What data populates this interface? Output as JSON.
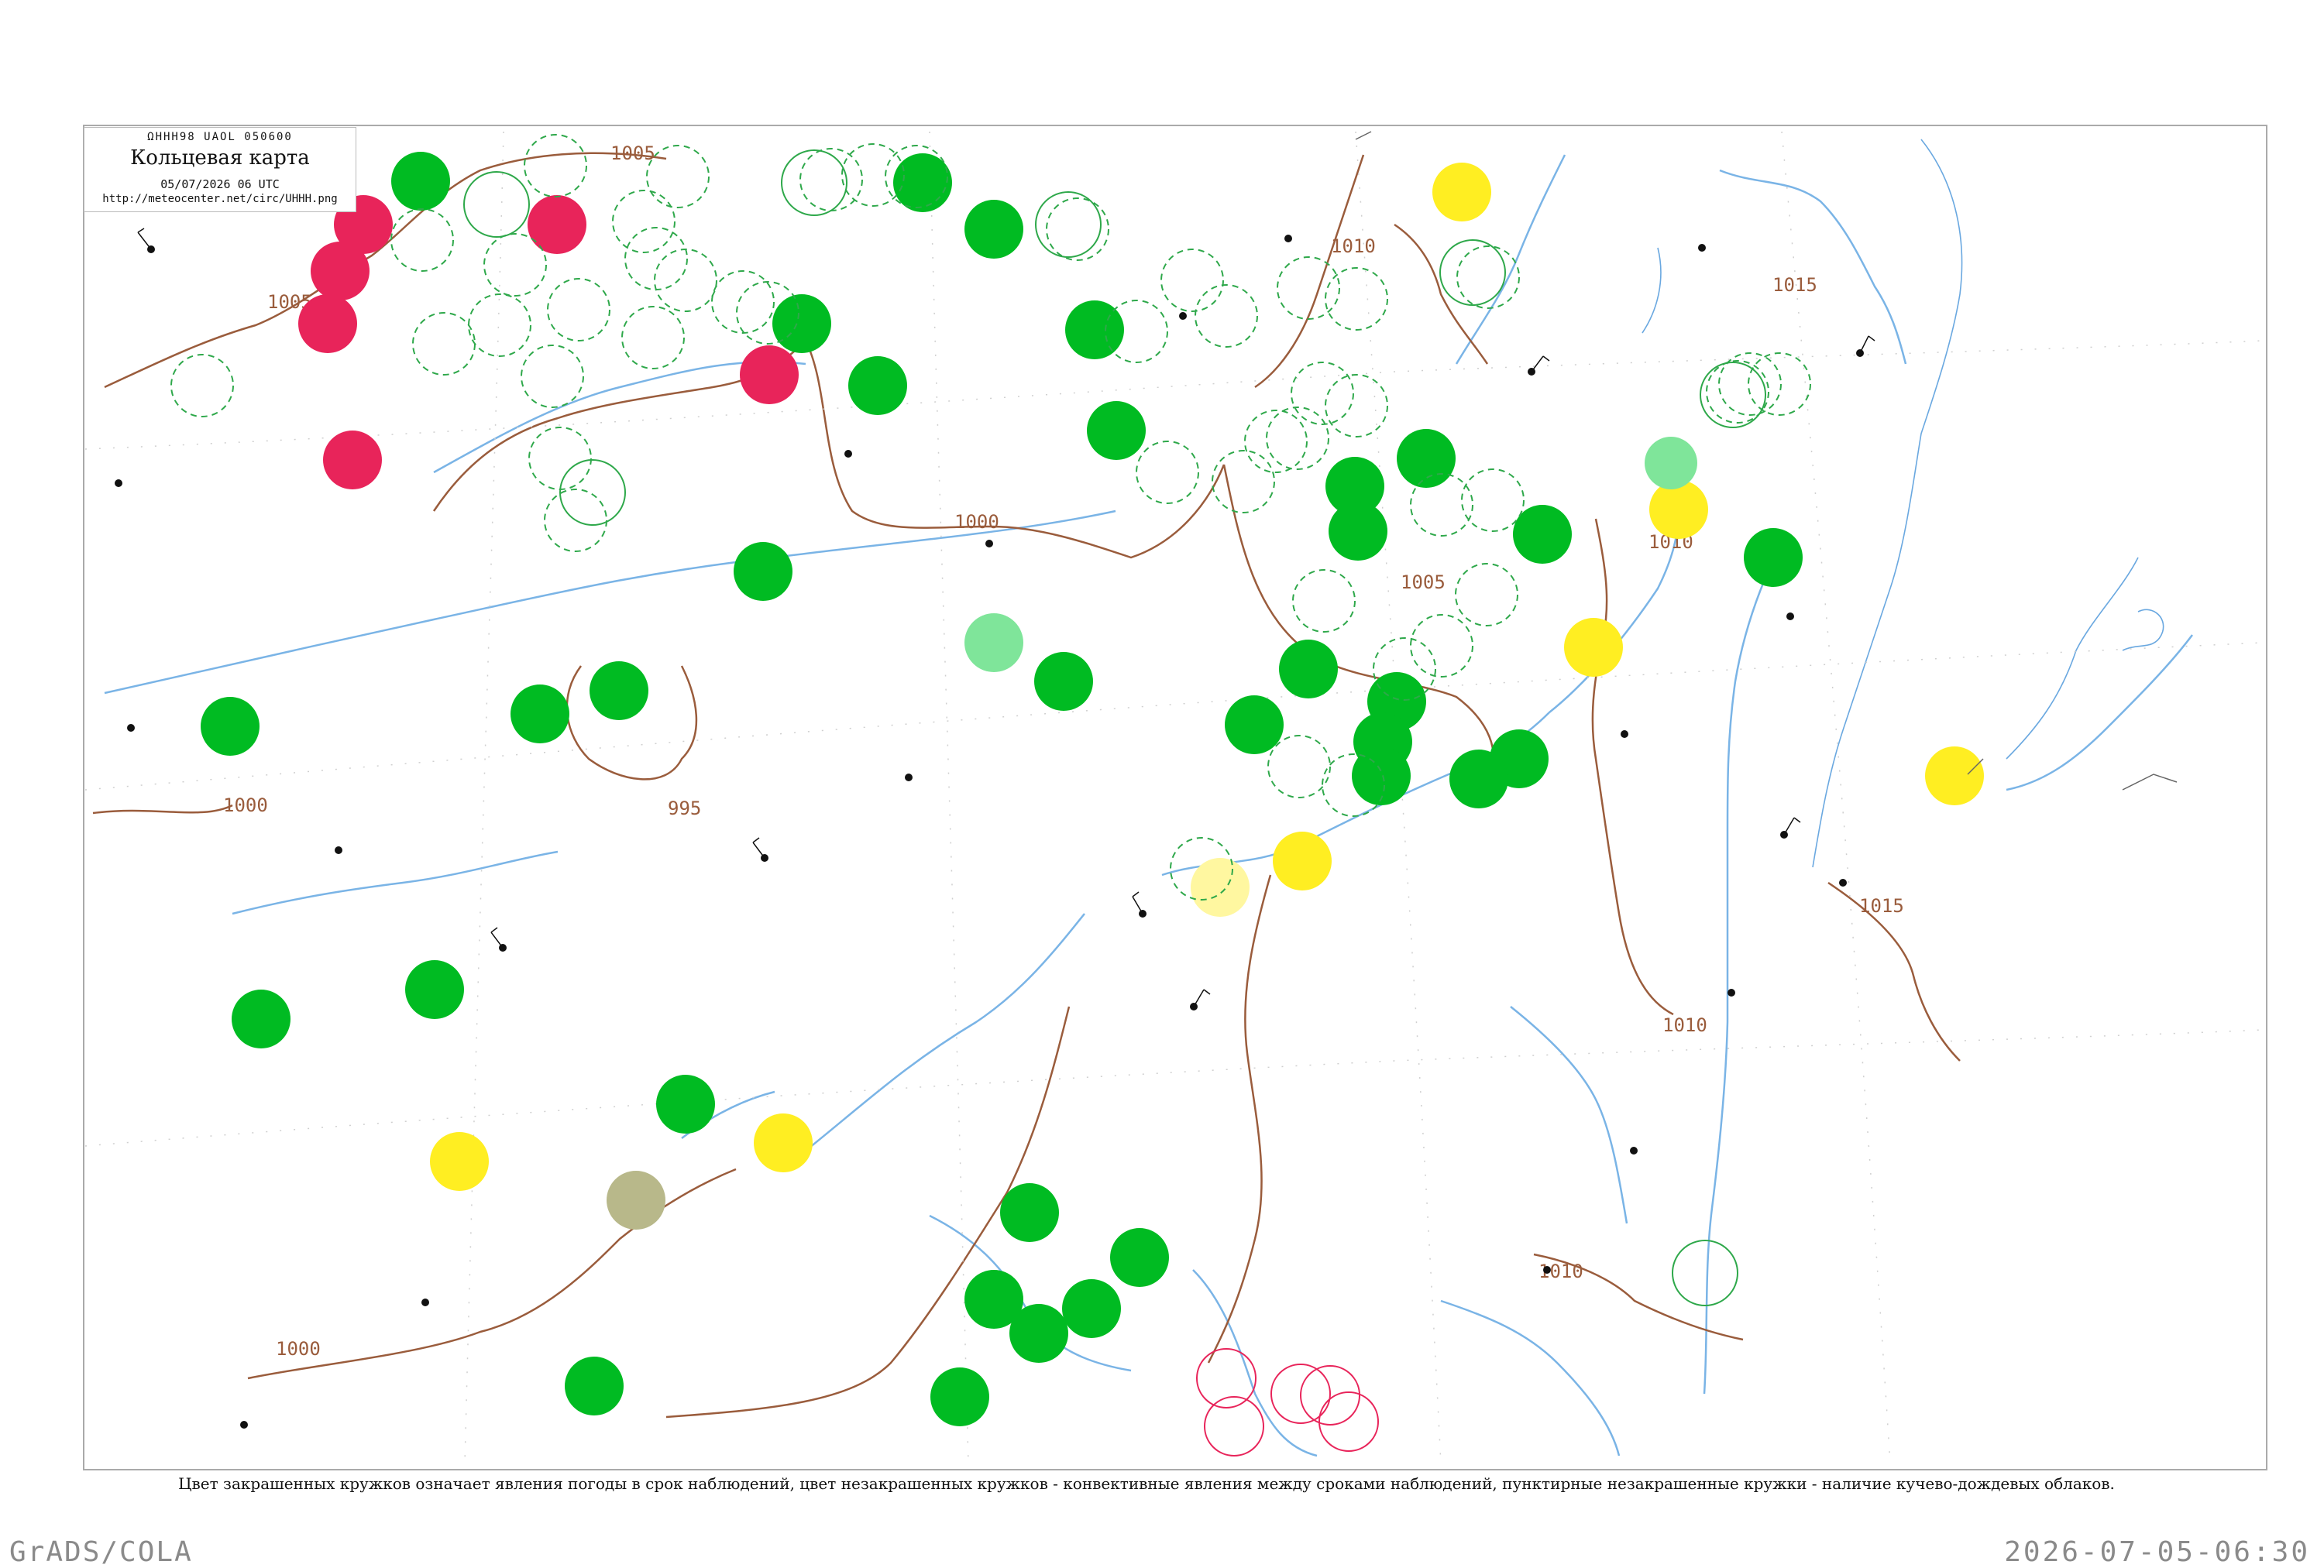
{
  "header": {
    "code": "ΩHHH98  UAOL  050600",
    "title": "Кольцевая карта",
    "date": "05/07/2026 06 UTC",
    "url": "http://meteocenter.net/circ/UHHH.png"
  },
  "isobars": [
    {
      "label": "1005"
    },
    {
      "label": "1005"
    },
    {
      "label": "1010"
    },
    {
      "label": "1000"
    },
    {
      "label": "1000"
    },
    {
      "label": "995"
    },
    {
      "label": "1005"
    },
    {
      "label": "1010"
    },
    {
      "label": "1015"
    },
    {
      "label": "1015"
    },
    {
      "label": "1010"
    },
    {
      "label": "1000"
    },
    {
      "label": "1010"
    }
  ],
  "legend_caption": "Цвет закрашенных кружков означает явления погоды в срок наблюдений, цвет незакрашенных кружков - конвективные явления между сроками наблюдений, пунктирные незакрашенные кружки - наличие кучево-дождевых облаков.",
  "footer": {
    "left": "GrADS/COLA",
    "right": "2026-07-05-06:30"
  },
  "colors": {
    "rain": "#00bb22",
    "thunderstorm": "#e8245a",
    "fog": "#ffee22",
    "dust": "#b8b88a",
    "shower_light": "#7fe59a",
    "ring": "#2ea84a",
    "isobar": "#9a5c3c",
    "river": "#7ab4e6",
    "text": "#111111"
  }
}
